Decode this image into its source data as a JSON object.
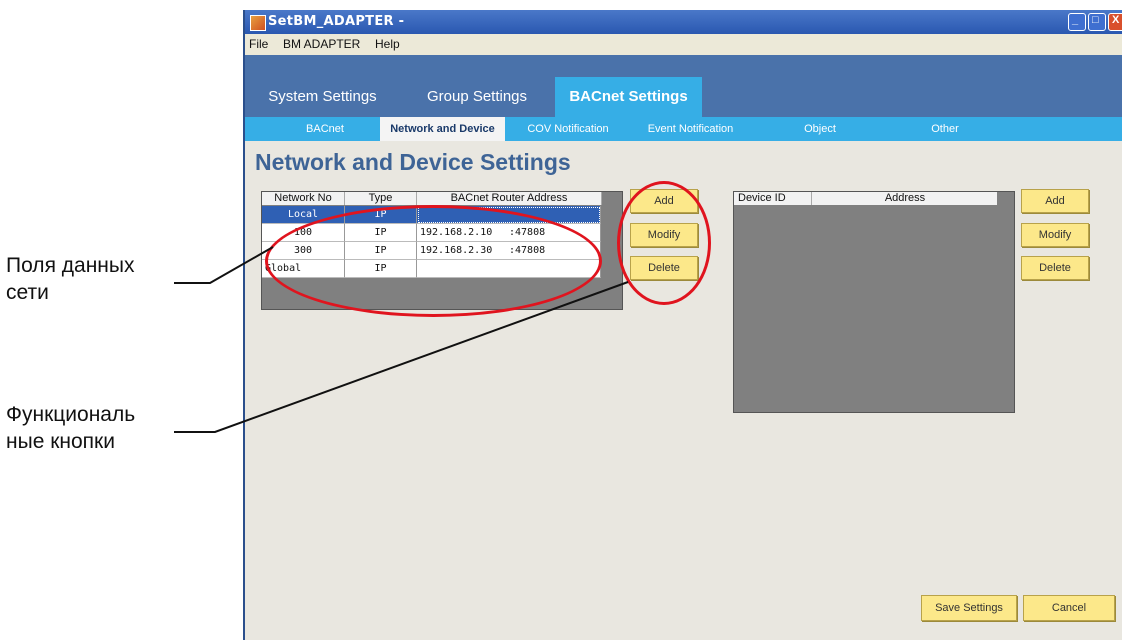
{
  "annotations": {
    "network_fields": [
      "Поля данных",
      "сети"
    ],
    "function_buttons": [
      "Функциональ",
      "ные кнопки"
    ]
  },
  "window": {
    "title": "SetBM_ADAPTER -",
    "controls": {
      "minimize": "_",
      "maximize": "□",
      "close": "X"
    }
  },
  "menu": [
    "File",
    "BM ADAPTER",
    "Help"
  ],
  "main_tabs": [
    "System Settings",
    "Group Settings",
    "BACnet Settings"
  ],
  "sub_tabs": [
    "BACnet",
    "Network and Device",
    "COV Notification",
    "Event Notification",
    "Object",
    "Other"
  ],
  "page_title": "Network and Device Settings",
  "network_table": {
    "columns": [
      "Network No",
      "Type",
      "BACnet Router Address"
    ],
    "rows": [
      {
        "network": "Local",
        "type": "IP",
        "ip": "",
        "port": ""
      },
      {
        "network": "100",
        "type": "IP",
        "ip": "192.168.2.10",
        "port": ":47808"
      },
      {
        "network": "300",
        "type": "IP",
        "ip": "192.168.2.30",
        "port": ":47808"
      },
      {
        "network": "Global",
        "type": "IP",
        "ip": "",
        "port": ""
      }
    ]
  },
  "network_buttons": {
    "add": "Add",
    "modify": "Modify",
    "delete": "Delete"
  },
  "device_table": {
    "columns": [
      "Device ID",
      "Address"
    ]
  },
  "device_buttons": {
    "add": "Add",
    "modify": "Modify",
    "delete": "Delete"
  },
  "footer_buttons": {
    "save": "Save Settings",
    "cancel": "Cancel"
  },
  "colors": {
    "highlight_ring": "#e0141e",
    "tab_active": "#36aee6",
    "button": "#fce88a"
  }
}
